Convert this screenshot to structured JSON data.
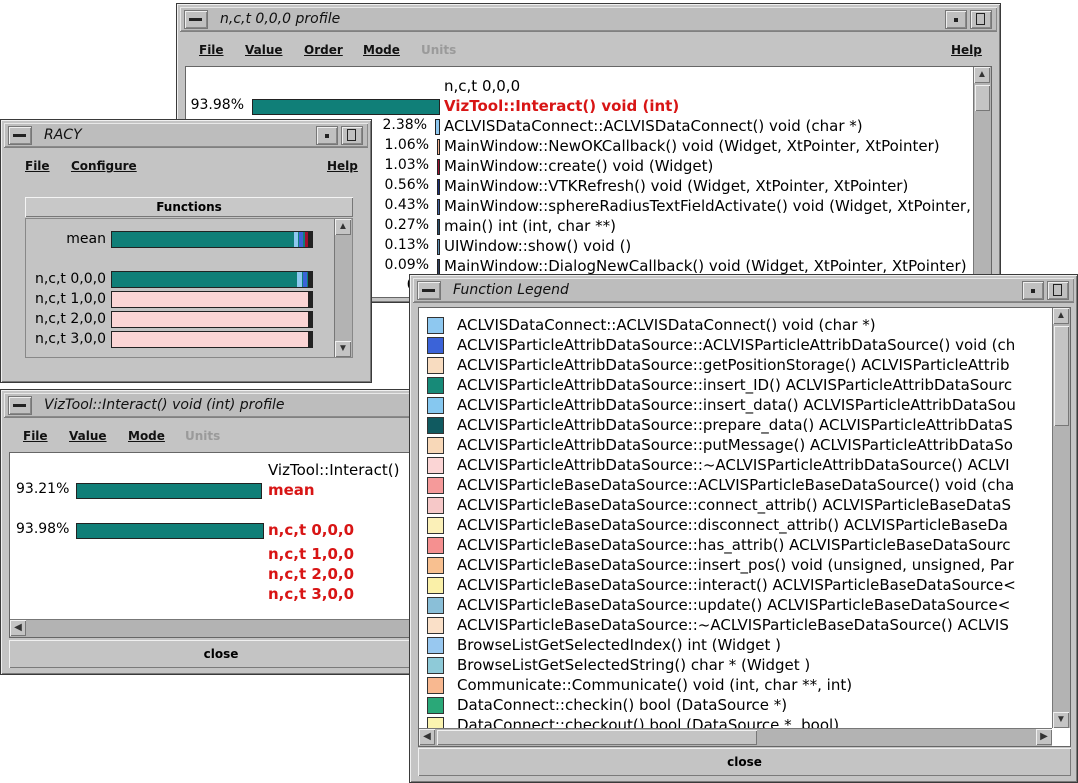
{
  "profile_window": {
    "title": "n,c,t 0,0,0 profile",
    "menu": [
      "File",
      "Value",
      "Order",
      "Mode",
      "Units",
      "Help"
    ],
    "header": "n,c,t 0,0,0",
    "rows": [
      {
        "pct": "93.98%",
        "fraction": 0.9398,
        "color": "#107f78",
        "name": "VizTool::Interact() void (int)",
        "highlight": true
      },
      {
        "pct": "2.38%",
        "fraction": 0.0238,
        "color": "#8ec8f0",
        "name": "ACLVISDataConnect::ACLVISDataConnect() void (char *)",
        "highlight": false
      },
      {
        "pct": "1.06%",
        "fraction": 0.0106,
        "color": "#f5b290",
        "name": "MainWindow::NewOKCallback() void (Widget, XtPointer, XtPointer)",
        "highlight": false
      },
      {
        "pct": "1.03%",
        "fraction": 0.0103,
        "color": "#a01030",
        "name": "MainWindow::create() void (Widget)",
        "highlight": false
      },
      {
        "pct": "0.56%",
        "fraction": 0.0056,
        "color": "#1a2f7a",
        "name": "MainWindow::VTKRefresh() void (Widget, XtPointer, XtPointer)",
        "highlight": false
      },
      {
        "pct": "0.43%",
        "fraction": 0.0043,
        "color": "#3c5fa0",
        "name": "MainWindow::sphereRadiusTextFieldActivate() void (Widget, XtPointer, XtPointer)",
        "highlight": false
      },
      {
        "pct": "0.27%",
        "fraction": 0.0027,
        "color": "#2a5070",
        "name": "main() int (int, char **)",
        "highlight": false
      },
      {
        "pct": "0.13%",
        "fraction": 0.0013,
        "color": "#5a8ab0",
        "name": "UIWindow::show() void ()",
        "highlight": false
      },
      {
        "pct": "0.09%",
        "fraction": 0.0009,
        "color": "#304060",
        "name": "MainWindow::DialogNewCallback() void (Widget, XtPointer, XtPointer)",
        "highlight": false
      },
      {
        "pct": "0.0",
        "fraction": 0.0,
        "color": "#444444",
        "name": "",
        "highlight": false
      }
    ]
  },
  "racy_window": {
    "title": "RACY",
    "menu": [
      "File",
      "Configure",
      "Help"
    ],
    "functions_button": "Functions",
    "mean_label": "mean",
    "threads": [
      "n,c,t 0,0,0",
      "n,c,t 1,0,0",
      "n,c,t 2,0,0",
      "n,c,t 3,0,0"
    ]
  },
  "viztool_window": {
    "title": "VizTool::Interact() void (int) profile",
    "menu": [
      "File",
      "Value",
      "Mode",
      "Units"
    ],
    "header": "VizTool::Interact()",
    "rows": [
      {
        "pct": "93.21%",
        "fraction": 0.9321,
        "label": "mean"
      },
      {
        "pct": "93.98%",
        "fraction": 0.9398,
        "label": "n,c,t 0,0,0"
      }
    ],
    "extra_labels": [
      "n,c,t 1,0,0",
      "n,c,t 2,0,0",
      "n,c,t 3,0,0"
    ],
    "close_label": "close"
  },
  "legend_window": {
    "title": "Function Legend",
    "items": [
      {
        "color": "#8ec8f0",
        "label": "ACLVISDataConnect::ACLVISDataConnect() void (char *)"
      },
      {
        "color": "#3b63d8",
        "label": "ACLVISParticleAttribDataSource::ACLVISParticleAttribDataSource() void (ch"
      },
      {
        "color": "#f8dcc0",
        "label": "ACLVISParticleAttribDataSource::getPositionStorage() ACLVISParticleAttrib"
      },
      {
        "color": "#178a78",
        "label": "ACLVISParticleAttribDataSource::insert_ID() ACLVISParticleAttribDataSourc"
      },
      {
        "color": "#86c8f0",
        "label": "ACLVISParticleAttribDataSource::insert_data() ACLVISParticleAttribDataSou"
      },
      {
        "color": "#105a60",
        "label": "ACLVISParticleAttribDataSource::prepare_data() ACLVISParticleAttribDataS"
      },
      {
        "color": "#f8d8b8",
        "label": "ACLVISParticleAttribDataSource::putMessage() ACLVISParticleAttribDataSo"
      },
      {
        "color": "#fbd5d5",
        "label": "ACLVISParticleAttribDataSource::~ACLVISParticleAttribDataSource() ACLVI"
      },
      {
        "color": "#f59a9a",
        "label": "ACLVISParticleBaseDataSource::ACLVISParticleBaseDataSource() void (cha"
      },
      {
        "color": "#f6c8c8",
        "label": "ACLVISParticleBaseDataSource::connect_attrib() ACLVISParticleBaseDataS"
      },
      {
        "color": "#fbf0b8",
        "label": "ACLVISParticleBaseDataSource::disconnect_attrib() ACLVISParticleBaseDa"
      },
      {
        "color": "#f59090",
        "label": "ACLVISParticleBaseDataSource::has_attrib() ACLVISParticleBaseDataSourc"
      },
      {
        "color": "#f8c090",
        "label": "ACLVISParticleBaseDataSource::insert_pos() void (unsigned, unsigned, Par"
      },
      {
        "color": "#faf0a8",
        "label": "ACLVISParticleBaseDataSource::interact() ACLVISParticleBaseDataSource<"
      },
      {
        "color": "#8abfd8",
        "label": "ACLVISParticleBaseDataSource::update() ACLVISParticleBaseDataSource<"
      },
      {
        "color": "#fae0c8",
        "label": "ACLVISParticleBaseDataSource::~ACLVISParticleBaseDataSource() ACLVIS"
      },
      {
        "color": "#98c8f0",
        "label": "BrowseListGetSelectedIndex() int (Widget )"
      },
      {
        "color": "#8ecad8",
        "label": "BrowseListGetSelectedString() char * (Widget )"
      },
      {
        "color": "#f8b890",
        "label": "Communicate::Communicate() void (int, char **, int)"
      },
      {
        "color": "#2aa878",
        "label": "DataConnect::checkin() bool (DataSource *)"
      },
      {
        "color": "#fbf4b0",
        "label": "DataConnect::checkout() bool (DataSource *, bool)"
      }
    ],
    "close_label": "close"
  }
}
